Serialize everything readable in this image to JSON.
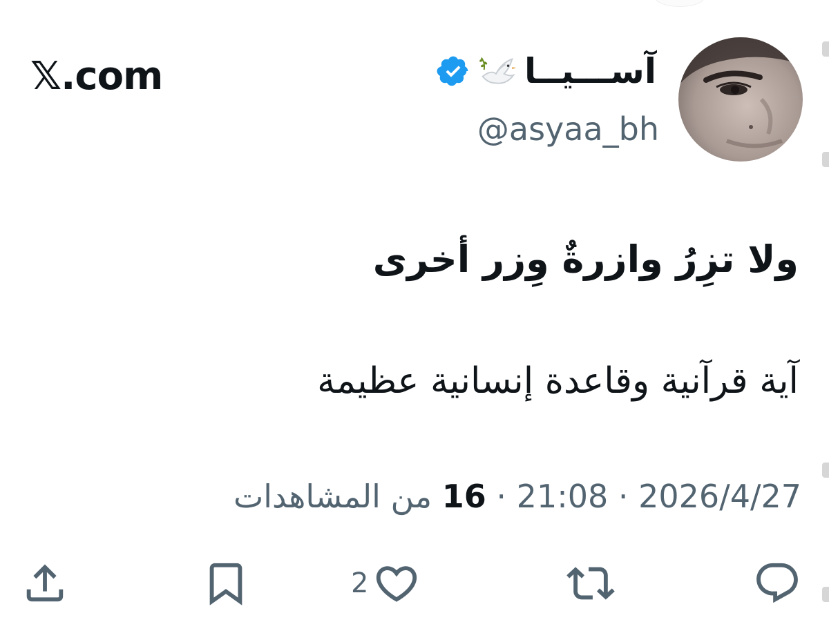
{
  "brand": {
    "text": "𝕏.com"
  },
  "author": {
    "display_name": "آســـيــا",
    "handle": "@asyaa_bh",
    "verified": true,
    "badge_icon": "verified-badge-icon",
    "emoji_icon": "dove-icon"
  },
  "tweet": {
    "line1": "ولا تزِرُ وازرةٌ وِزر أخرى",
    "line2": "آية قرآنية وقاعدة إنسانية عظيمة"
  },
  "meta": {
    "date": "2026/4/27",
    "separator": "·",
    "time": "21:08",
    "views_count": "16",
    "views_label": "من المشاهدات"
  },
  "actions": {
    "reply_icon": "reply-icon",
    "repost_icon": "repost-icon",
    "like_icon": "heart-icon",
    "like_count": "2",
    "bookmark_icon": "bookmark-icon",
    "share_icon": "share-icon"
  },
  "colors": {
    "text_primary": "#0f1419",
    "text_secondary": "#536471",
    "verified_blue": "#1d9bf0"
  }
}
